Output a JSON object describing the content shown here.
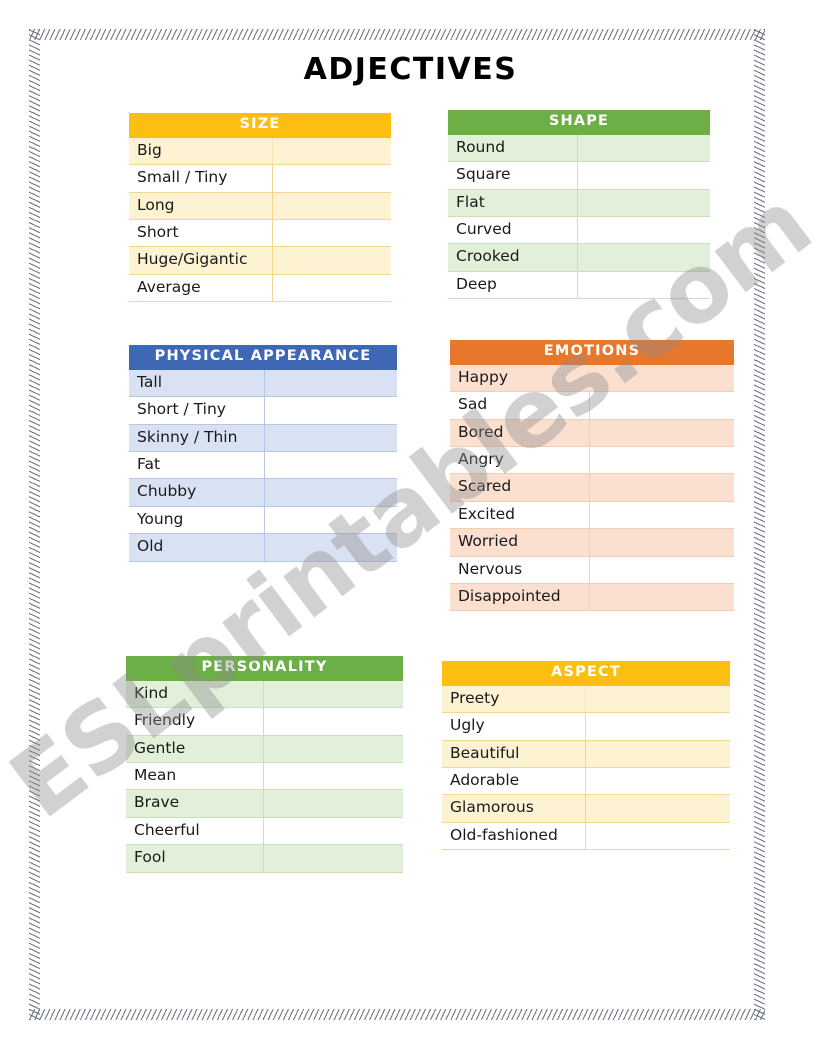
{
  "page": {
    "title": "ADJECTIVES",
    "watermark": "ESLprintables.com",
    "border_style": "zigzag-frame"
  },
  "colors": {
    "amber_header": "#FBBE11",
    "amber_row": "#FDF2D2",
    "green_header": "#6CAF46",
    "green_row": "#E2EFD9",
    "blue_header": "#3E67B5",
    "blue_row": "#D9E2F3",
    "orange_header": "#E8772E",
    "orange_row": "#FBE0D0",
    "text": "#1a1a1a",
    "header_text": "#FFFFFF"
  },
  "tables": {
    "size": {
      "header": "SIZE",
      "rows": [
        {
          "label": "Big",
          "answer": ""
        },
        {
          "label": "Small / Tiny",
          "answer": ""
        },
        {
          "label": "Long",
          "answer": ""
        },
        {
          "label": "Short",
          "answer": ""
        },
        {
          "label": "Huge/Gigantic",
          "answer": ""
        },
        {
          "label": "Average",
          "answer": ""
        }
      ]
    },
    "shape": {
      "header": "SHAPE",
      "rows": [
        {
          "label": "Round",
          "answer": ""
        },
        {
          "label": "Square",
          "answer": ""
        },
        {
          "label": "Flat",
          "answer": ""
        },
        {
          "label": "Curved",
          "answer": ""
        },
        {
          "label": "Crooked",
          "answer": ""
        },
        {
          "label": "Deep",
          "answer": ""
        }
      ]
    },
    "physical": {
      "header": "PHYSICAL APPEARANCE",
      "rows": [
        {
          "label": "Tall",
          "answer": ""
        },
        {
          "label": "Short / Tiny",
          "answer": ""
        },
        {
          "label": "Skinny / Thin",
          "answer": ""
        },
        {
          "label": "Fat",
          "answer": ""
        },
        {
          "label": "Chubby",
          "answer": ""
        },
        {
          "label": "Young",
          "answer": ""
        },
        {
          "label": "Old",
          "answer": ""
        }
      ]
    },
    "emotions": {
      "header": "EMOTIONS",
      "rows": [
        {
          "label": "Happy",
          "answer": ""
        },
        {
          "label": "Sad",
          "answer": ""
        },
        {
          "label": "Bored",
          "answer": ""
        },
        {
          "label": "Angry",
          "answer": ""
        },
        {
          "label": "Scared",
          "answer": ""
        },
        {
          "label": "Excited",
          "answer": ""
        },
        {
          "label": "Worried",
          "answer": ""
        },
        {
          "label": "Nervous",
          "answer": ""
        },
        {
          "label": "Disappointed",
          "answer": ""
        }
      ]
    },
    "personality": {
      "header": "PERSONALITY",
      "rows": [
        {
          "label": "Kind",
          "answer": ""
        },
        {
          "label": "Friendly",
          "answer": ""
        },
        {
          "label": "Gentle",
          "answer": ""
        },
        {
          "label": "Mean",
          "answer": ""
        },
        {
          "label": "Brave",
          "answer": ""
        },
        {
          "label": "Cheerful",
          "answer": ""
        },
        {
          "label": "Fool",
          "answer": ""
        }
      ]
    },
    "aspect": {
      "header": "ASPECT",
      "rows": [
        {
          "label": "Preety",
          "answer": ""
        },
        {
          "label": "Ugly",
          "answer": ""
        },
        {
          "label": "Beautiful",
          "answer": ""
        },
        {
          "label": "Adorable",
          "answer": ""
        },
        {
          "label": "Glamorous",
          "answer": ""
        },
        {
          "label": "Old-fashioned",
          "answer": ""
        }
      ]
    }
  }
}
